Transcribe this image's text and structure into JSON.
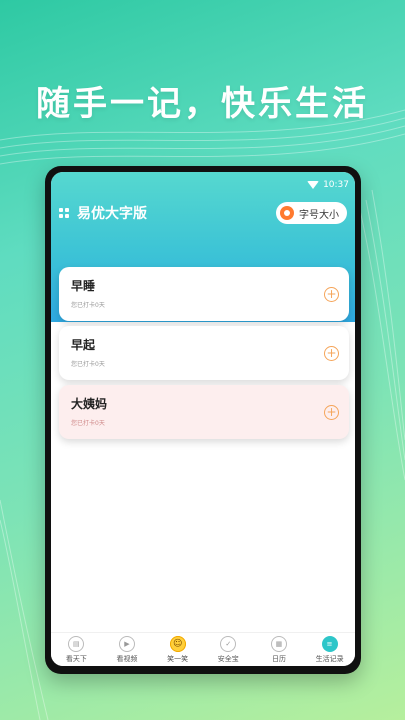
{
  "headline": "随手一记，快乐生活",
  "status_time": "10:37",
  "app_title": "易优大字版",
  "font_size_button": "字号大小",
  "cards": [
    {
      "title": "早睡",
      "subtitle": "您已打卡0天"
    },
    {
      "title": "早起",
      "subtitle": "您已打卡0天"
    },
    {
      "title": "大姨妈",
      "subtitle": "您已打卡0天"
    }
  ],
  "tabs": [
    {
      "label": "看天下",
      "icon": "news-icon"
    },
    {
      "label": "看视频",
      "icon": "video-icon"
    },
    {
      "label": "笑一笑",
      "icon": "smile-icon"
    },
    {
      "label": "安全宝",
      "icon": "shield-icon"
    },
    {
      "label": "日历",
      "icon": "calendar-icon"
    },
    {
      "label": "生活记录",
      "icon": "record-icon"
    }
  ],
  "colors": {
    "accent": "#2ec6c9",
    "plus": "#f5a55a",
    "gear": "#ff7a2f",
    "pink_card": "#fdeeee"
  }
}
